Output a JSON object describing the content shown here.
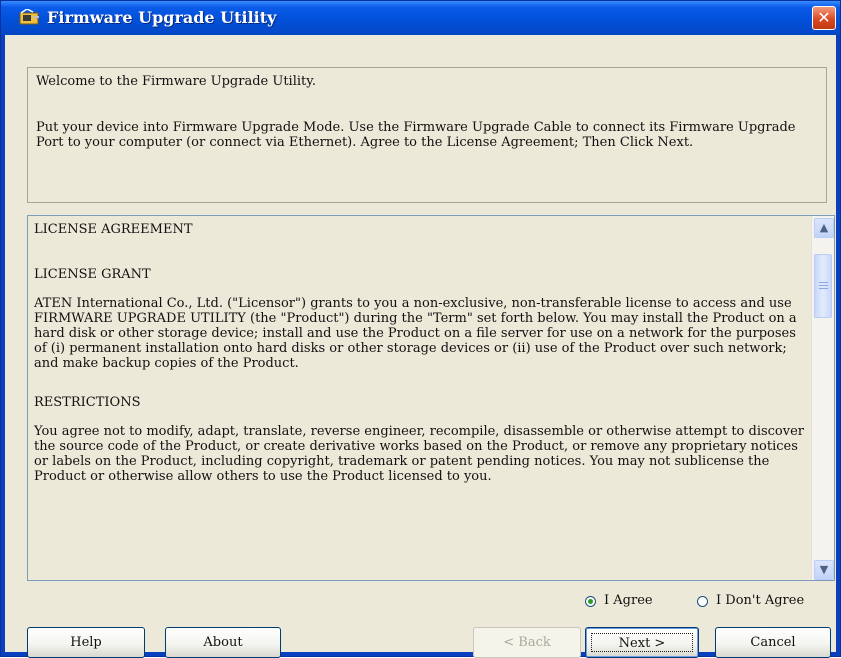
{
  "window": {
    "title": "Firmware Upgrade Utility",
    "close_glyph": "✕",
    "accent_color": "#0250da"
  },
  "header": {
    "welcome": "Welcome to the Firmware Upgrade Utility.",
    "instructions": "Put your device into Firmware Upgrade Mode. Use the Firmware Upgrade Cable to connect its Firmware Upgrade Port to your computer (or connect via Ethernet). Agree to the License Agreement; Then Click Next."
  },
  "license": {
    "title": "LICENSE AGREEMENT",
    "sections": [
      {
        "heading": "LICENSE GRANT",
        "body": "ATEN International Co., Ltd. (\"Licensor\") grants to you a non-exclusive, non-transferable license to access and use FIRMWARE UPGRADE UTILITY (the \"Product\") during the \"Term\" set forth below. You may install the Product on a hard disk or other storage device; install and use the Product on a file server for use on a network for the purposes of (i) permanent installation onto hard disks or other storage devices or (ii) use of the Product over such network; and make backup copies of the Product."
      },
      {
        "heading": "RESTRICTIONS",
        "body": "You agree not to modify, adapt, translate, reverse engineer, recompile, disassemble or otherwise attempt to discover the source code of the Product, or create derivative works based on the Product, or remove any proprietary notices or labels on the Product, including copyright, trademark or patent pending notices. You may not sublicense the Product or otherwise allow others to use the Product licensed to you."
      }
    ],
    "scroll_up_glyph": "▲",
    "scroll_down_glyph": "▼"
  },
  "agreement": {
    "agree_label": "I Agree",
    "disagree_label": "I Don't Agree",
    "selected": "agree"
  },
  "buttons": {
    "help": "Help",
    "about": "About",
    "back": "< Back",
    "next": "Next >",
    "cancel": "Cancel"
  },
  "icons": {
    "title_icon": "firmware-chip-icon",
    "close": "close-icon"
  }
}
